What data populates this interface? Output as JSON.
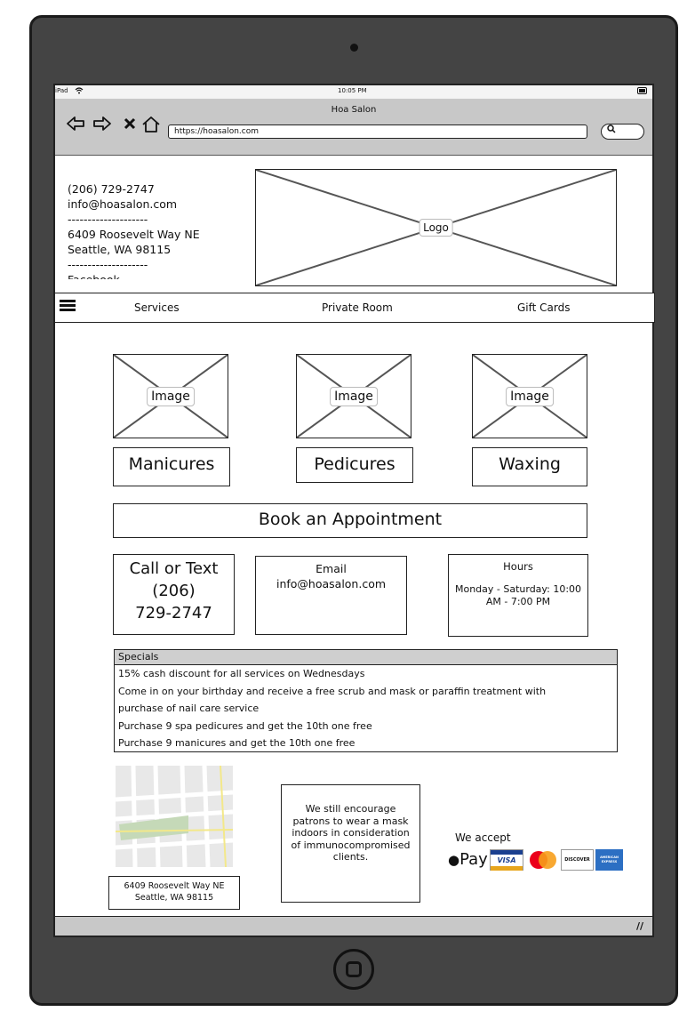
{
  "status_bar": {
    "device": "iPad",
    "time": "10:05 PM"
  },
  "browser": {
    "window_title": "Hoa Salon",
    "url": "https://hoasalon.com",
    "back_icon": "back-arrow-icon",
    "forward_icon": "forward-arrow-icon",
    "stop_icon": "close-icon",
    "home_icon": "home-icon",
    "search_icon": "search-icon"
  },
  "header": {
    "phone": "(206) 729-2747",
    "email": "info@hoasalon.com",
    "sep1": "--------------------",
    "address_line1": "6409 Roosevelt Way NE",
    "address_line2": "Seattle, WA 98115",
    "sep2": "--------------------",
    "social": "Facebook",
    "logo_label": "Logo"
  },
  "nav": {
    "menu_icon": "hamburger-menu-icon",
    "items": [
      {
        "label": "Services"
      },
      {
        "label": "Private Room"
      },
      {
        "label": "Gift Cards"
      }
    ]
  },
  "services": [
    {
      "image_label": "Image",
      "title": "Manicures"
    },
    {
      "image_label": "Image",
      "title": "Pedicures"
    },
    {
      "image_label": "Image",
      "title": "Waxing"
    }
  ],
  "book_button": "Book an Appointment",
  "info_cards": {
    "call_title": "Call or Text",
    "call_number_1": "(206)",
    "call_number_2": "729-2747",
    "email_title": "Email",
    "email_value": "info@hoasalon.com",
    "hours_title": "Hours",
    "hours_line1": "Monday - Saturday: 10:00",
    "hours_line2": "AM - 7:00 PM"
  },
  "specials": {
    "header": "Specials",
    "rows": [
      "15% cash discount for all services on Wednesdays",
      "Come in on your birthday and receive a free scrub and mask or paraffin treatment with",
      "purchase of nail care service",
      "Purchase 9 spa pedicures and get the 10th one free",
      "Purchase 9 manicures and get the 10th one free"
    ]
  },
  "footer": {
    "address_line1": "6409 Roosevelt Way NE",
    "address_line2": "Seattle, WA 98115",
    "mask_notice": "We still encourage patrons to wear a mask indoors in consideration of immunocompromised clients.",
    "accept_label": "We accept",
    "apple_pay": "Pay",
    "visa": "VISA",
    "discover": "DISCOVER",
    "amex": "AMERICAN EXPRESS",
    "payment_icons": [
      "apple-pay-icon",
      "visa-icon",
      "mastercard-icon",
      "discover-icon",
      "amex-icon"
    ]
  }
}
